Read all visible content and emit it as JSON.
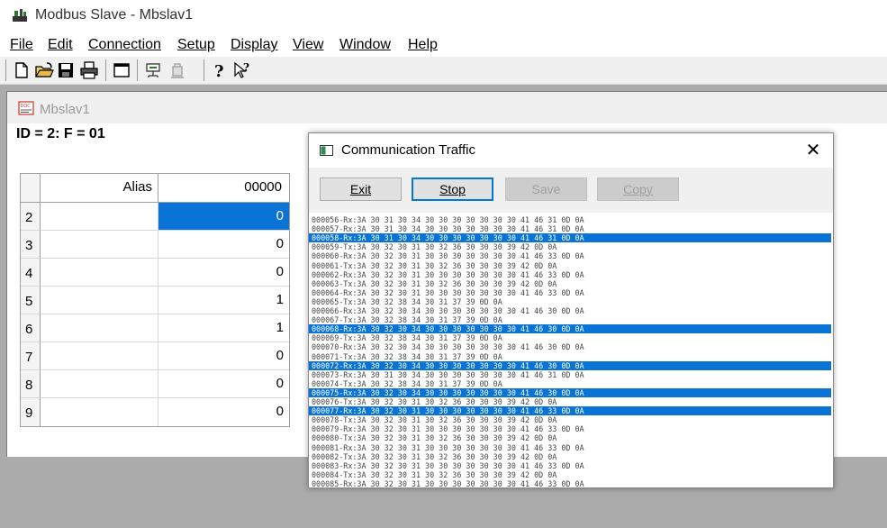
{
  "app": {
    "title": "Modbus Slave - Mbslav1"
  },
  "menu": [
    "File",
    "Edit",
    "Connection",
    "Setup",
    "Display",
    "View",
    "Window",
    "Help"
  ],
  "toolbar": {
    "icons": [
      "new-file-icon",
      "open-folder-icon",
      "save-icon",
      "print-icon",
      "window-icon",
      "connect-icon",
      "disconnect-icon",
      "about-icon",
      "context-help-icon"
    ]
  },
  "child": {
    "title": "Mbslav1",
    "id_line": "ID = 2: F = 01",
    "grid": {
      "alias_header": "Alias",
      "col_header": "00000",
      "rows": [
        {
          "row": "2",
          "alias": "",
          "value": "0",
          "selected": true
        },
        {
          "row": "3",
          "alias": "",
          "value": "0",
          "selected": false
        },
        {
          "row": "4",
          "alias": "",
          "value": "0",
          "selected": false
        },
        {
          "row": "5",
          "alias": "",
          "value": "1",
          "selected": false
        },
        {
          "row": "6",
          "alias": "",
          "value": "1",
          "selected": false
        },
        {
          "row": "7",
          "alias": "",
          "value": "0",
          "selected": false
        },
        {
          "row": "8",
          "alias": "",
          "value": "0",
          "selected": false
        },
        {
          "row": "9",
          "alias": "",
          "value": "0",
          "selected": false
        }
      ]
    }
  },
  "dialog": {
    "title": "Communication Traffic",
    "close_label": "✕",
    "buttons": {
      "exit": "Exit",
      "stop": "Stop",
      "save": "Save",
      "copy": "Copy"
    },
    "lines": [
      {
        "text": "000056-Rx:3A 30 31 30 34 30 30 30 30 30 30 30 41 46 31 0D 0A",
        "sel": false
      },
      {
        "text": "000057-Rx:3A 30 31 30 34 30 30 30 30 30 30 30 41 46 31 0D 0A",
        "sel": false
      },
      {
        "text": "000058-Rx:3A 30 31 30 34 30 30 30 30 30 30 30 41 46 31 0D 0A",
        "sel": true
      },
      {
        "text": "000059-Tx:3A 30 32 30 31 30 32 36 30 30 30 39 42 0D 0A",
        "sel": false
      },
      {
        "text": "000060-Rx:3A 30 32 30 31 30 30 30 30 30 30 30 41 46 33 0D 0A",
        "sel": false
      },
      {
        "text": "000061-Tx:3A 30 32 30 31 30 32 36 30 30 30 39 42 0D 0A",
        "sel": false
      },
      {
        "text": "000062-Rx:3A 30 32 30 31 30 30 30 30 30 30 30 41 46 33 0D 0A",
        "sel": false
      },
      {
        "text": "000063-Tx:3A 30 32 30 31 30 32 36 30 30 30 39 42 0D 0A",
        "sel": false
      },
      {
        "text": "000064-Rx:3A 30 32 30 31 30 30 30 30 30 30 30 41 46 33 0D 0A",
        "sel": false
      },
      {
        "text": "000065-Tx:3A 30 32 38 34 30 31 37 39 0D 0A",
        "sel": false
      },
      {
        "text": "000066-Rx:3A 30 32 30 34 30 30 30 30 30 30 30 41 46 30 0D 0A",
        "sel": false
      },
      {
        "text": "000067-Tx:3A 30 32 38 34 30 31 37 39 0D 0A",
        "sel": false
      },
      {
        "text": "000068-Rx:3A 30 32 30 34 30 30 30 30 30 30 30 41 46 30 0D 0A",
        "sel": true
      },
      {
        "text": "000069-Tx:3A 30 32 38 34 30 31 37 39 0D 0A",
        "sel": false
      },
      {
        "text": "000070-Rx:3A 30 32 30 34 30 30 30 30 30 30 30 41 46 30 0D 0A",
        "sel": false
      },
      {
        "text": "000071-Tx:3A 30 32 38 34 30 31 37 39 0D 0A",
        "sel": false
      },
      {
        "text": "000072-Rx:3A 30 32 30 34 30 30 30 30 30 30 30 41 46 30 0D 0A",
        "sel": true
      },
      {
        "text": "000073-Rx:3A 30 31 30 34 30 30 30 30 30 30 30 41 46 31 0D 0A",
        "sel": false
      },
      {
        "text": "000074-Tx:3A 30 32 38 34 30 31 37 39 0D 0A",
        "sel": false
      },
      {
        "text": "000075-Rx:3A 30 32 30 34 30 30 30 30 30 30 30 41 46 30 0D 0A",
        "sel": true
      },
      {
        "text": "000076-Tx:3A 30 32 30 31 30 32 36 30 30 30 39 42 0D 0A",
        "sel": false
      },
      {
        "text": "000077-Rx:3A 30 32 30 31 30 30 30 30 30 30 30 41 46 33 0D 0A",
        "sel": true
      },
      {
        "text": "000078-Tx:3A 30 32 30 31 30 32 36 30 30 30 39 42 0D 0A",
        "sel": false
      },
      {
        "text": "000079-Rx:3A 30 32 30 31 30 30 30 30 30 30 30 41 46 33 0D 0A",
        "sel": false
      },
      {
        "text": "000080-Tx:3A 30 32 30 31 30 32 36 30 30 30 39 42 0D 0A",
        "sel": false
      },
      {
        "text": "000081-Rx:3A 30 32 30 31 30 30 30 30 30 30 30 41 46 33 0D 0A",
        "sel": false
      },
      {
        "text": "000082-Tx:3A 30 32 30 31 30 32 36 30 30 30 39 42 0D 0A",
        "sel": false
      },
      {
        "text": "000083-Rx:3A 30 32 30 31 30 30 30 30 30 30 30 41 46 33 0D 0A",
        "sel": false
      },
      {
        "text": "000084-Tx:3A 30 32 30 31 30 32 36 30 30 30 39 42 0D 0A",
        "sel": false
      },
      {
        "text": "000085-Rx:3A 30 32 30 31 30 30 30 30 30 30 30 41 46 33 0D 0A",
        "sel": false
      }
    ]
  },
  "colors": {
    "selection": "#0a73d6",
    "focus_border": "#0078d7"
  }
}
